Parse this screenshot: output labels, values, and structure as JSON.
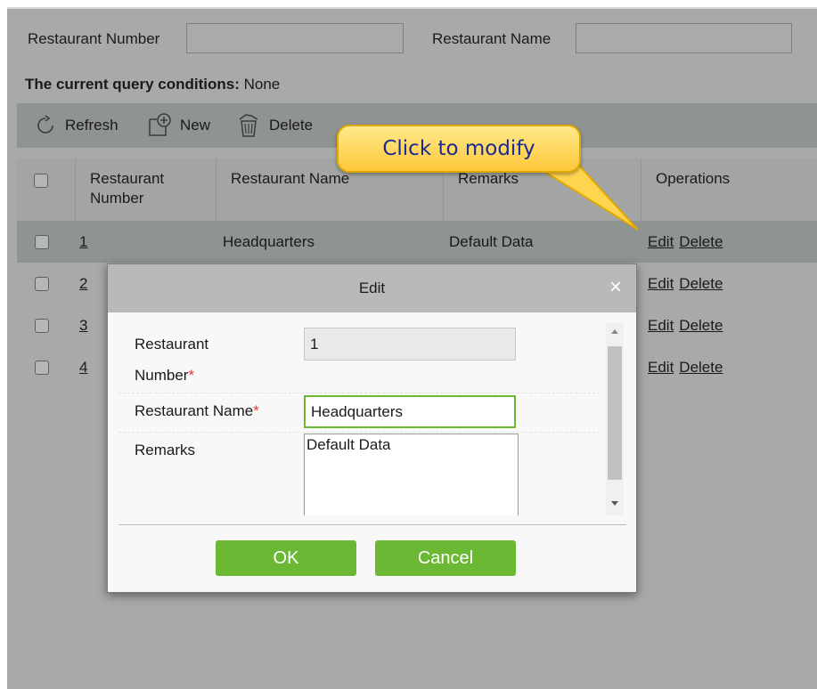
{
  "search": {
    "restaurant_number_label": "Restaurant Number",
    "restaurant_number_value": "",
    "restaurant_name_label": "Restaurant Name",
    "restaurant_name_value": ""
  },
  "query": {
    "label": "The current query conditions:",
    "value": "None"
  },
  "toolbar": {
    "refresh_label": "Refresh",
    "new_label": "New",
    "delete_label": "Delete"
  },
  "table": {
    "headers": {
      "number": "Restaurant Number",
      "name": "Restaurant Name",
      "remarks": "Remarks",
      "operations": "Operations"
    },
    "rows": [
      {
        "number": "1",
        "name": "Headquarters",
        "remarks": "Default Data",
        "edit": "Edit",
        "delete": "Delete"
      },
      {
        "number": "2",
        "name": "",
        "remarks": "",
        "edit": "Edit",
        "delete": "Delete"
      },
      {
        "number": "3",
        "name": "",
        "remarks": "",
        "edit": "Edit",
        "delete": "Delete"
      },
      {
        "number": "4",
        "name": "",
        "remarks": "",
        "edit": "Edit",
        "delete": "Delete"
      }
    ]
  },
  "callout": {
    "text": "Click to modify"
  },
  "modal": {
    "title": "Edit",
    "close": "×",
    "fields": {
      "number_label_line1": "Restaurant",
      "number_label_line2": "Number",
      "number_value": "1",
      "name_label": "Restaurant Name",
      "name_value": "Headquarters",
      "remarks_label": "Remarks",
      "remarks_value": "Default Data",
      "required_mark": "*"
    },
    "ok_label": "OK",
    "cancel_label": "Cancel"
  },
  "colors": {
    "overlay": "#a8aaa9",
    "toolbar": "#8f9391",
    "button_green": "#6ab833",
    "callout_fill": "#ffd54f",
    "callout_text": "#1d2b8f",
    "required": "#e53935"
  }
}
